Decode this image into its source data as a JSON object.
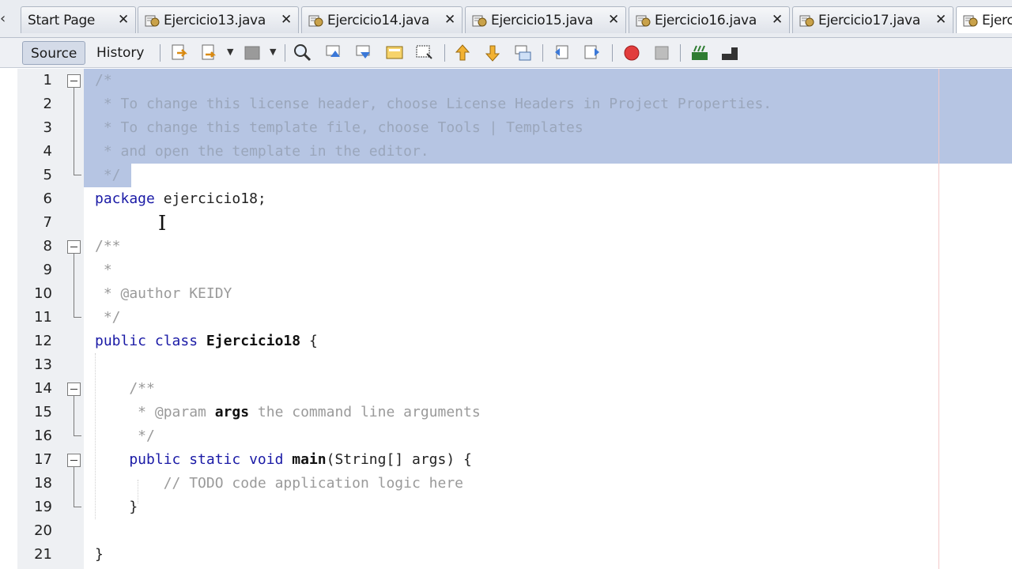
{
  "tabs": [
    {
      "label": "Start Page",
      "has_icon": false
    },
    {
      "label": "Ejercicio13.java",
      "has_icon": true
    },
    {
      "label": "Ejercicio14.java",
      "has_icon": true
    },
    {
      "label": "Ejercicio15.java",
      "has_icon": true
    },
    {
      "label": "Ejercicio16.java",
      "has_icon": true
    },
    {
      "label": "Ejercicio17.java",
      "has_icon": true
    },
    {
      "label": "Ejerc",
      "has_icon": true,
      "active": true
    }
  ],
  "tab_close_glyph": "✕",
  "toolbar": {
    "source_label": "Source",
    "history_label": "History",
    "icons": [
      "last-edit-icon",
      "back-icon",
      "forward-icon",
      "find-icon",
      "find-previous-icon",
      "find-next-icon",
      "toggle-highlight-icon",
      "toggle-rect-select-icon",
      "previous-bookmark-icon",
      "next-bookmark-icon",
      "toggle-bookmark-icon",
      "shift-left-icon",
      "shift-right-icon",
      "start-macro-icon",
      "stop-macro-icon",
      "comment-icon",
      "uncomment-icon"
    ]
  },
  "editor": {
    "lines": [
      {
        "num": "1",
        "text": "/*"
      },
      {
        "num": "2",
        "text": " * To change this license header, choose License Headers in Project Properties."
      },
      {
        "num": "3",
        "text": " * To change this template file, choose Tools | Templates"
      },
      {
        "num": "4",
        "text": " * and open the template in the editor."
      },
      {
        "num": "5",
        "text": " */"
      },
      {
        "num": "6",
        "text_kw": "package",
        "text_rest": " ejercicio18;"
      },
      {
        "num": "7",
        "text": ""
      },
      {
        "num": "8",
        "text": "/**"
      },
      {
        "num": "9",
        "text": " *"
      },
      {
        "num": "10",
        "text": " * @author KEIDY"
      },
      {
        "num": "11",
        "text": " */"
      },
      {
        "num": "12",
        "text_kw": "public class",
        "text_bold": "Ejercicio18",
        "text_rest": " {"
      },
      {
        "num": "13",
        "text": ""
      },
      {
        "num": "14",
        "text": "    /**"
      },
      {
        "num": "15",
        "text_a": "     * @param ",
        "text_bold": "args",
        "text_b": " the command line arguments"
      },
      {
        "num": "16",
        "text": "     */"
      },
      {
        "num": "17",
        "text_kw": "    public static void",
        "text_bold": "main",
        "text_rest": "(String[] args) {"
      },
      {
        "num": "18",
        "text": "        // TODO code application logic here"
      },
      {
        "num": "19",
        "text": "    }"
      },
      {
        "num": "20",
        "text": ""
      },
      {
        "num": "21",
        "text": "}"
      }
    ]
  },
  "colors": {
    "selection": "#b6c5e3",
    "keyword": "#1a1aa6",
    "comment": "#9a9a9a"
  }
}
